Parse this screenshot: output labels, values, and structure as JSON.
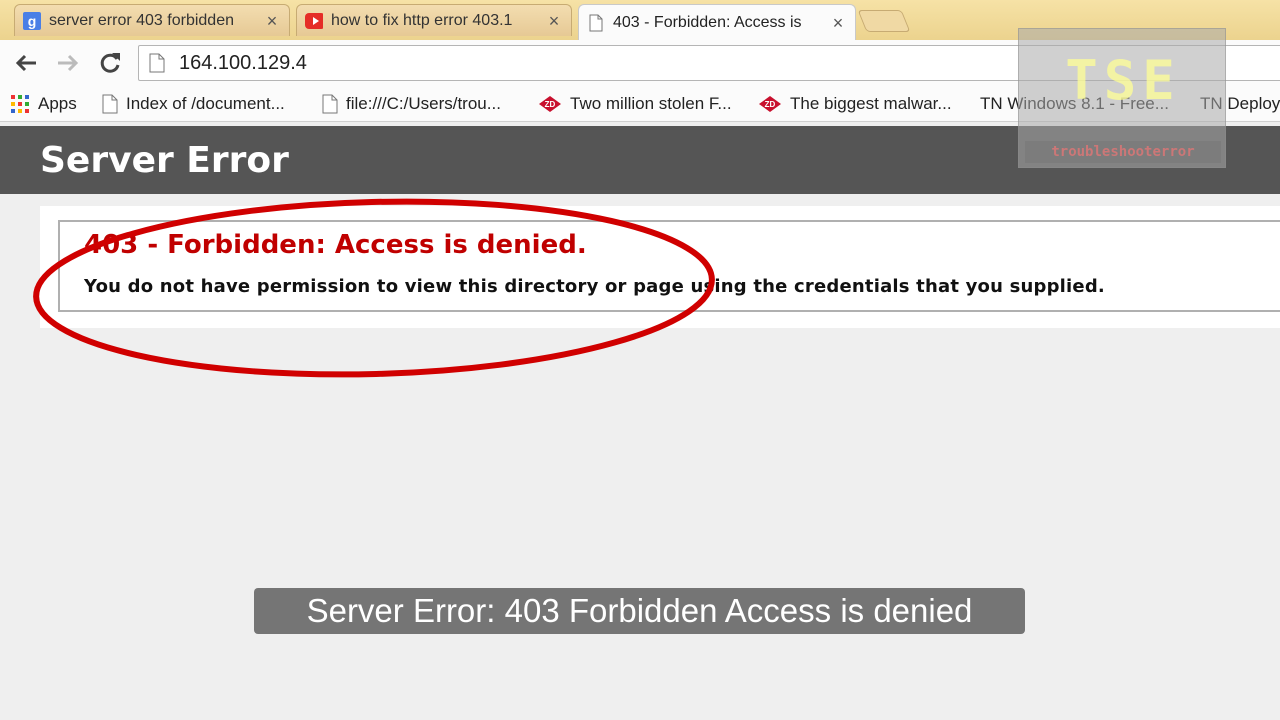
{
  "browser": {
    "tabs": [
      {
        "title": "server error 403 forbidden",
        "icon": "google-icon",
        "active": false
      },
      {
        "title": "how to fix http error 403.1",
        "icon": "youtube-icon",
        "active": false
      },
      {
        "title": "403 - Forbidden: Access is",
        "icon": "page-icon",
        "active": true
      }
    ],
    "close_glyph": "×",
    "url": "164.100.129.4",
    "bookmarks": [
      {
        "label": "Apps",
        "icon": "apps-grid-icon"
      },
      {
        "label": "Index of /document...",
        "icon": "page-icon"
      },
      {
        "label": "file:///C:/Users/trou...",
        "icon": "page-icon"
      },
      {
        "label": "Two million stolen F...",
        "icon": "zd-icon"
      },
      {
        "label": "The biggest malwar...",
        "icon": "zd-icon"
      },
      {
        "label": "TN Windows 8.1 - Free...",
        "icon": "text-favicon"
      },
      {
        "label": "TN Deploy",
        "icon": "text-favicon"
      }
    ]
  },
  "page": {
    "header": "Server Error",
    "error_heading": "403 - Forbidden: Access is denied.",
    "error_message": "You do not have permission to view this directory or page using the credentials that you supplied."
  },
  "watermark": {
    "logo": "TSE",
    "text": "troubleshooterror"
  },
  "caption": "Server Error: 403 Forbidden Access is denied",
  "colors": {
    "error_red": "#c00000",
    "header_bg": "#555555",
    "annotation": "#d00000"
  }
}
